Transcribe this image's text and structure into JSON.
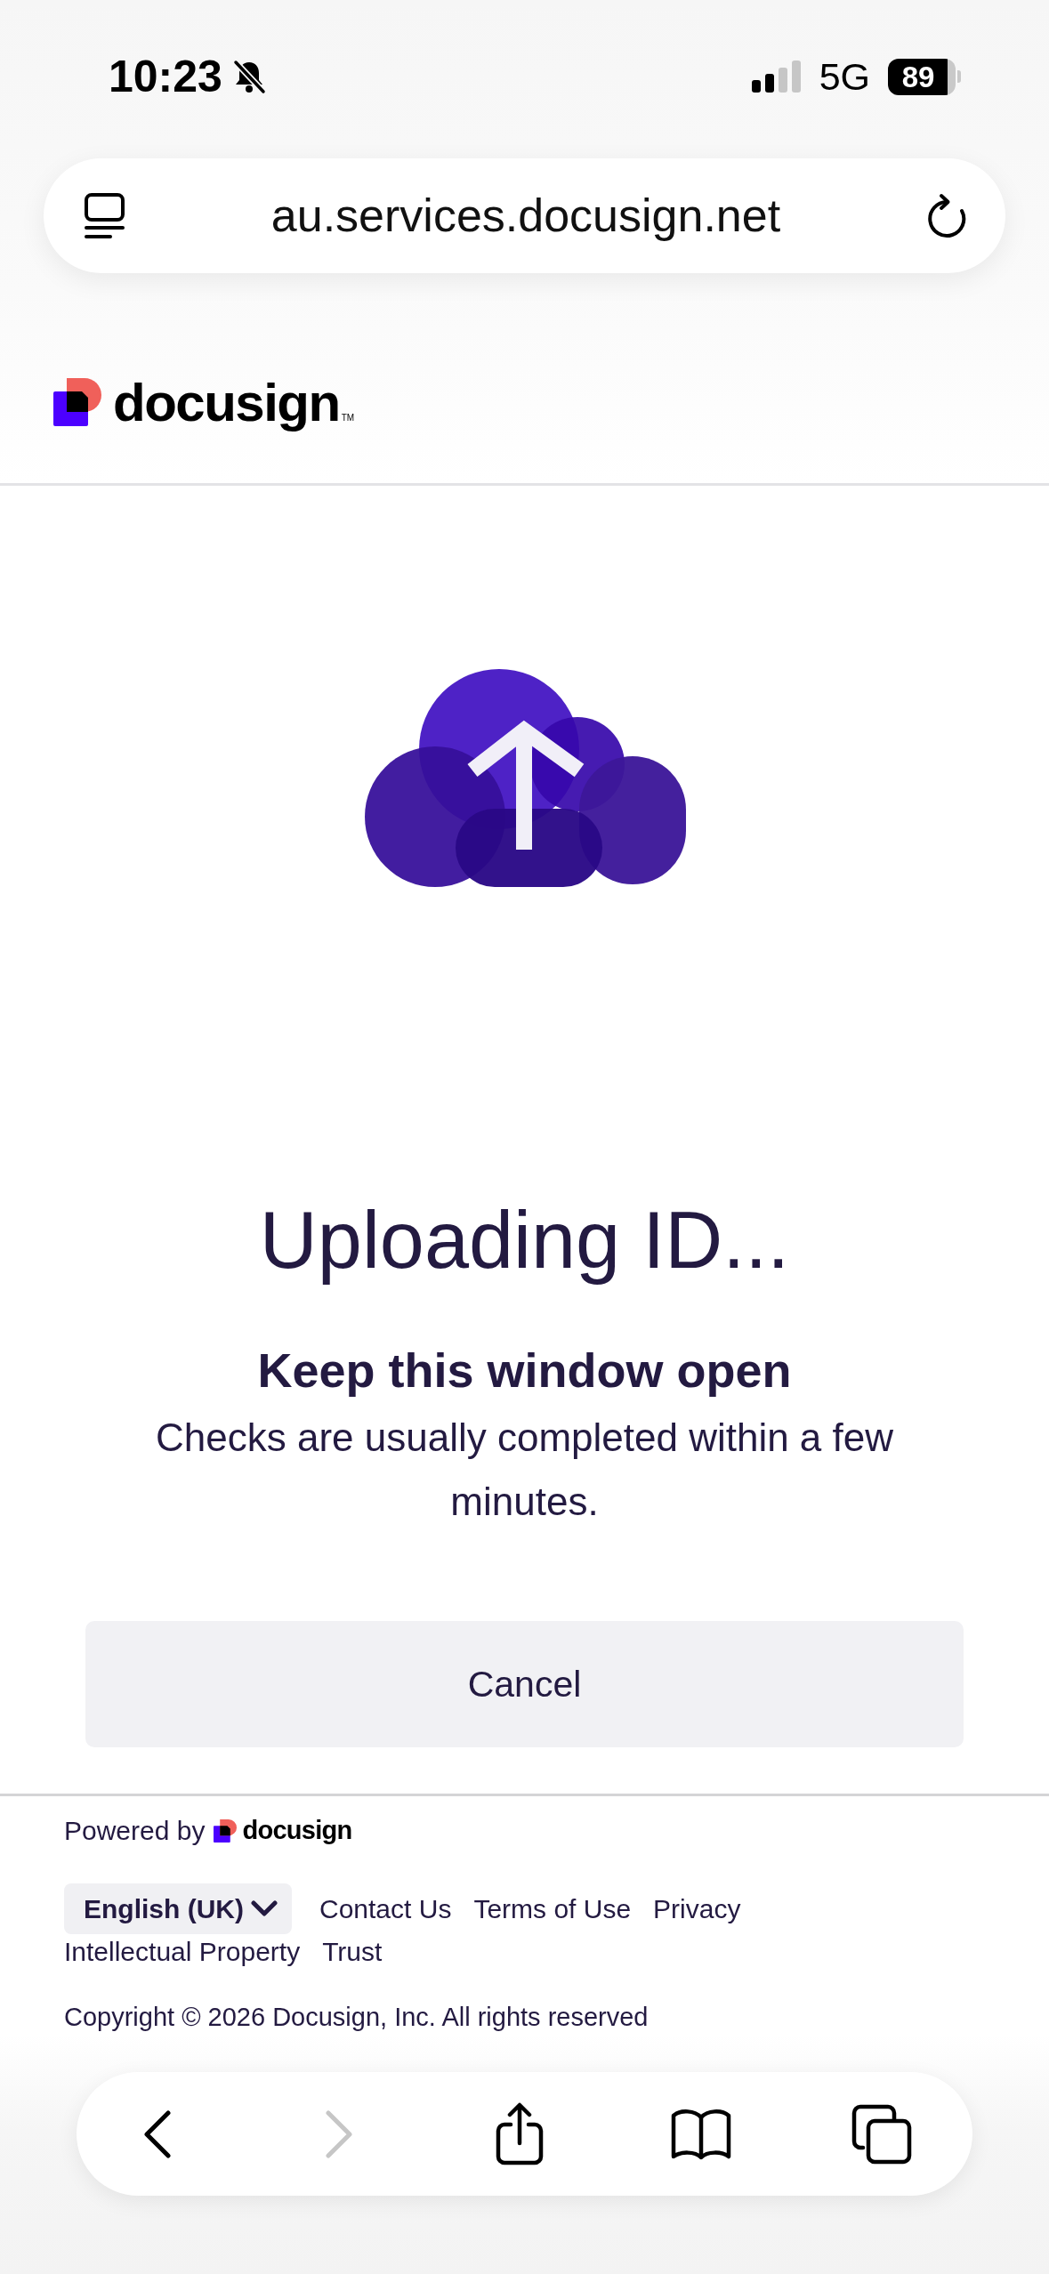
{
  "status_bar": {
    "time": "10:23",
    "silent": true,
    "network": "5G",
    "battery": "89"
  },
  "address_bar": {
    "url": "au.services.docusign.net"
  },
  "header": {
    "logo": "docusign",
    "trademark": "TM"
  },
  "upload": {
    "title": "Uploading ID...",
    "subtitle": "Keep this window open",
    "message": "Checks are usually completed within a few minutes."
  },
  "cancel_button": "Cancel",
  "footer": {
    "powered_by": "Powered by",
    "logo": "docusign",
    "language": "English (UK)",
    "links": [
      "Contact Us",
      "Terms of Use",
      "Privacy",
      "Intellectual Property",
      "Trust"
    ],
    "copyright": "Copyright © 2026 Docusign, Inc. All rights reserved"
  },
  "toolbar": {
    "buttons": [
      {
        "kind": "back",
        "disabled": false
      },
      {
        "kind": "forward",
        "disabled": true
      },
      {
        "kind": "share",
        "disabled": false
      },
      {
        "kind": "bookmarks",
        "disabled": false
      },
      {
        "kind": "tabs",
        "disabled": false
      }
    ]
  }
}
